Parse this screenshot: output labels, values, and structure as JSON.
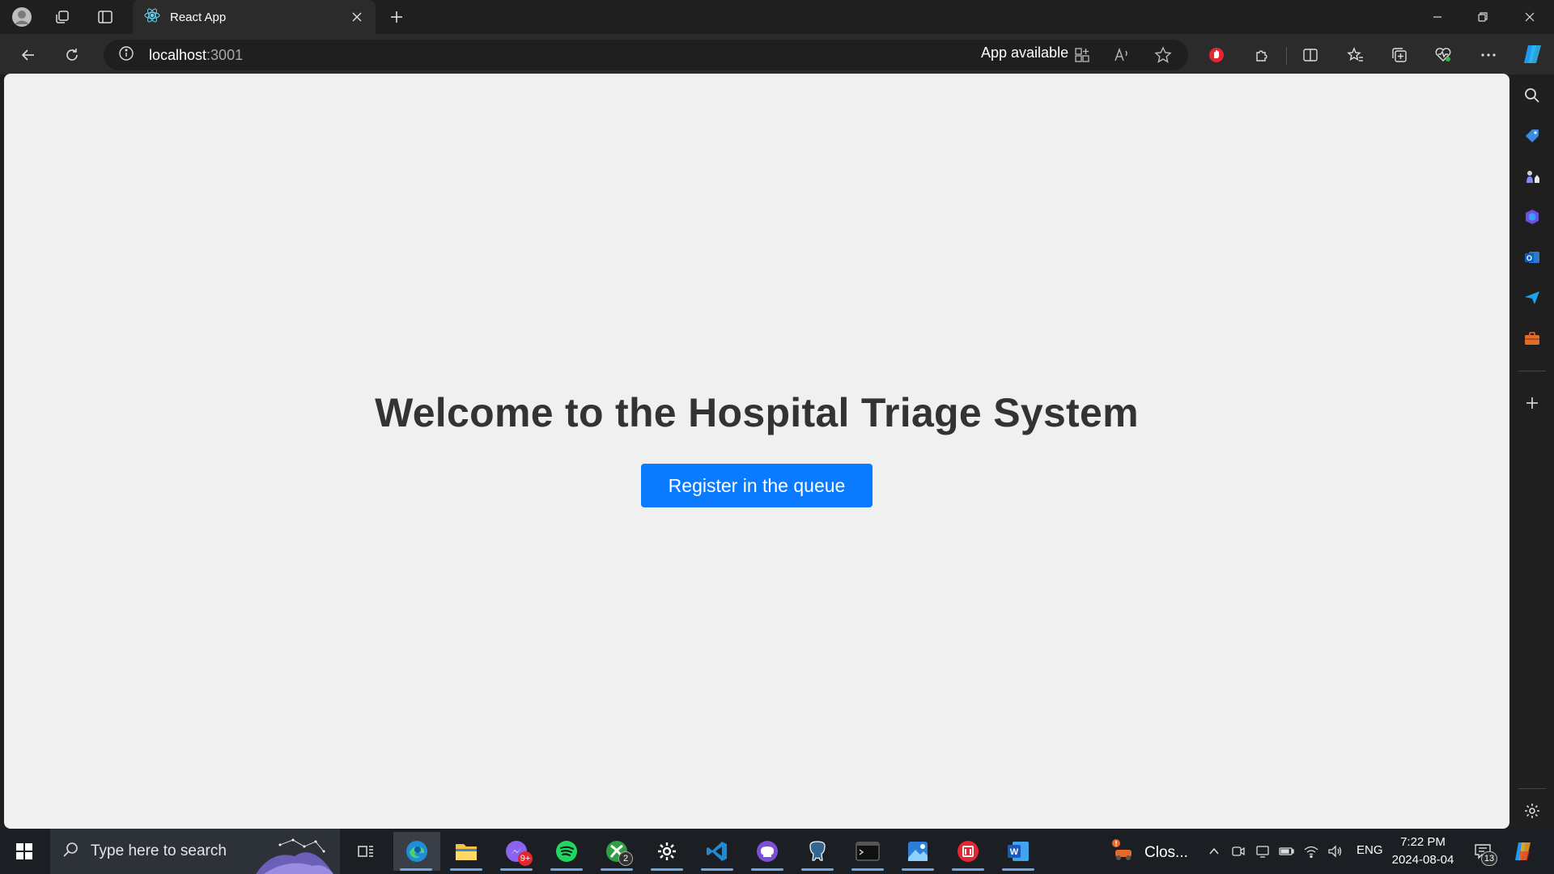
{
  "browser": {
    "tab_title": "React App",
    "url_host": "localhost",
    "url_port": ":3001",
    "app_available_label": "App available"
  },
  "page": {
    "heading": "Welcome to the Hospital Triage System",
    "register_button_label": "Register in the queue"
  },
  "taskbar": {
    "search_placeholder": "Type here to search",
    "apps": [
      {
        "name": "edge-icon",
        "active": true
      },
      {
        "name": "file-explorer-icon"
      },
      {
        "name": "messenger-icon",
        "badge": "9+"
      },
      {
        "name": "spotify-icon"
      },
      {
        "name": "xbox-icon",
        "badge": "2"
      },
      {
        "name": "settings-icon"
      },
      {
        "name": "vscode-icon"
      },
      {
        "name": "github-desktop-icon"
      },
      {
        "name": "postgresql-icon"
      },
      {
        "name": "terminal-icon"
      },
      {
        "name": "photos-icon"
      },
      {
        "name": "red-app-icon"
      },
      {
        "name": "word-icon"
      }
    ],
    "weather_label": "Clos...",
    "language": "ENG",
    "time": "7:22 PM",
    "date": "2024-08-04",
    "notification_count": "13"
  },
  "colors": {
    "accent": "#0a7bff",
    "page_background": "#f0f0f0",
    "heading": "#333333",
    "browser_chrome": "#1f1f1f"
  }
}
